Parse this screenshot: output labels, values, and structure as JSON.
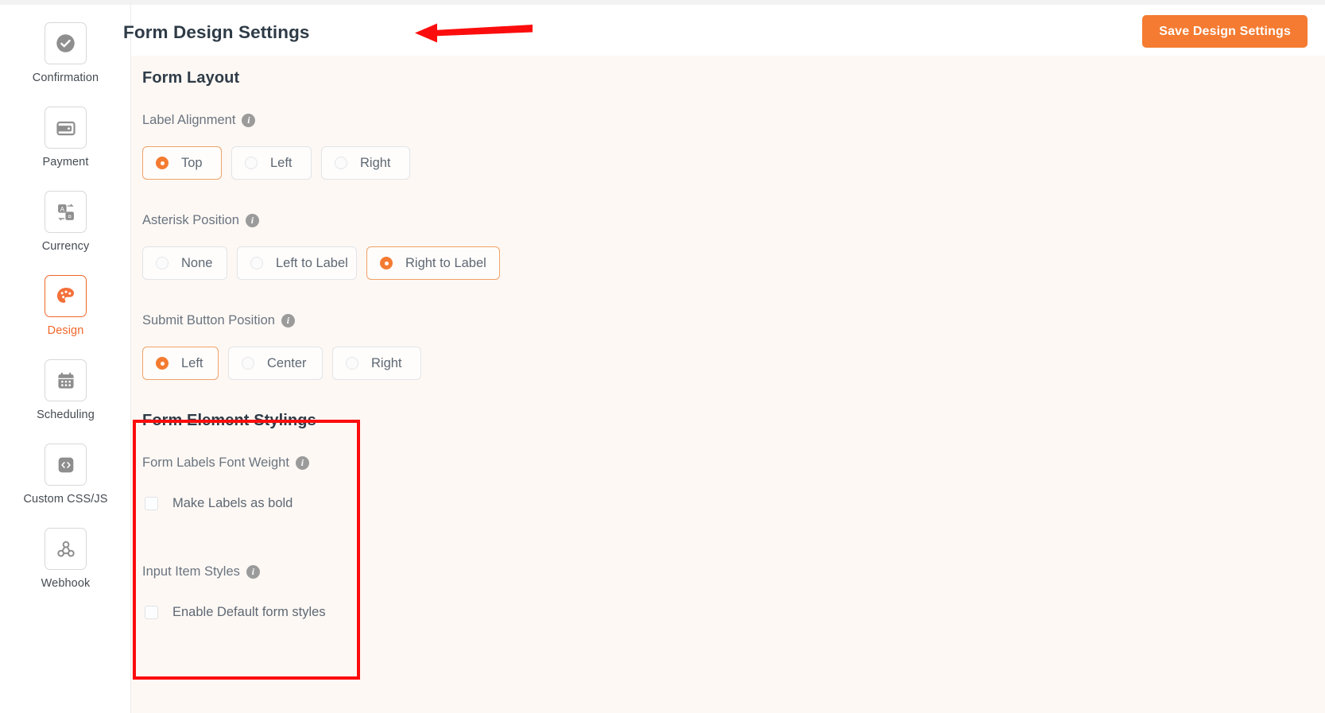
{
  "header": {
    "title": "Form Design Settings",
    "save_label": "Save Design Settings",
    "accent_color": "#f47b31",
    "annotation_color": "#fc0d0d"
  },
  "sidebar": {
    "items": [
      {
        "label": "Confirmation",
        "icon": "check-circle-icon",
        "active": false
      },
      {
        "label": "Payment",
        "icon": "wallet-icon",
        "active": false
      },
      {
        "label": "Currency",
        "icon": "translate-currency-icon",
        "active": false
      },
      {
        "label": "Design",
        "icon": "palette-icon",
        "active": true
      },
      {
        "label": "Scheduling",
        "icon": "calendar-icon",
        "active": false
      },
      {
        "label": "Custom CSS/JS",
        "icon": "code-brackets-icon",
        "active": false
      },
      {
        "label": "Webhook",
        "icon": "webhook-icon",
        "active": false
      }
    ]
  },
  "panel": {
    "background_color": "#fdf8f4",
    "sections": [
      {
        "title": "Form Layout",
        "fields": [
          {
            "label": "Label Alignment",
            "info": "i",
            "type": "radio-group",
            "options": [
              {
                "label": "Top",
                "selected": true
              },
              {
                "label": "Left",
                "selected": false
              },
              {
                "label": "Right",
                "selected": false
              }
            ]
          },
          {
            "label": "Asterisk Position",
            "info": "i",
            "type": "radio-group",
            "options": [
              {
                "label": "None",
                "selected": false
              },
              {
                "label": "Left to Label",
                "selected": false
              },
              {
                "label": "Right to Label",
                "selected": true
              }
            ]
          },
          {
            "label": "Submit Button Position",
            "info": "i",
            "type": "radio-group",
            "options": [
              {
                "label": "Left",
                "selected": true
              },
              {
                "label": "Center",
                "selected": false
              },
              {
                "label": "Right",
                "selected": false
              }
            ]
          }
        ]
      },
      {
        "title": "Form Element Stylings",
        "highlighted": true,
        "fields": [
          {
            "label": "Form Labels Font Weight",
            "info": "i",
            "type": "checkbox",
            "checkbox_label": "Make Labels as bold",
            "checked": false
          },
          {
            "label": "Input Item Styles",
            "info": "i",
            "type": "checkbox",
            "checkbox_label": "Enable Default form styles",
            "checked": false
          }
        ]
      }
    ]
  }
}
